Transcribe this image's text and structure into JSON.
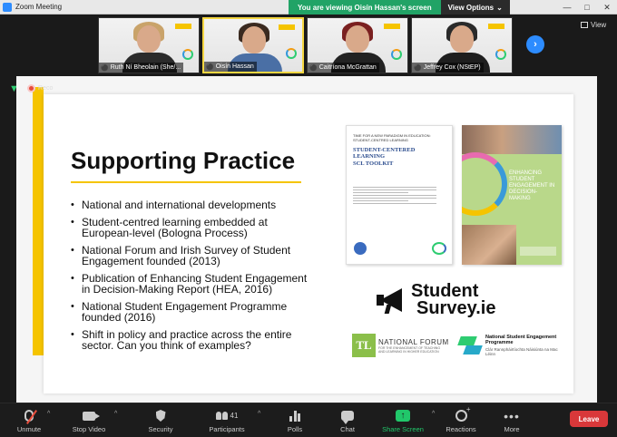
{
  "window": {
    "title": "Zoom Meeting"
  },
  "share_banner": {
    "viewing_text": "You are viewing Oisín Hassan's screen",
    "view_options_label": "View Options"
  },
  "top_right": {
    "view_label": "View"
  },
  "participants": [
    {
      "name": "Ruth Ní Bheolain (She/...",
      "hair_color": "#c9a36a",
      "body_color": "#2b2b2b",
      "muted": true
    },
    {
      "name": "Oisín Hassan",
      "hair_color": "#3a2a20",
      "body_color": "#4a6fa5",
      "muted": true,
      "active": true
    },
    {
      "name": "Caitríona McGrattan",
      "hair_color": "#7a2020",
      "body_color": "#222222",
      "muted": true
    },
    {
      "name": "Jeffrey Cox (NStEP)",
      "hair_color": "#2a2a2a",
      "body_color": "#1e1e1e",
      "muted": true
    }
  ],
  "recording_label": "Reco",
  "slide": {
    "title": "Supporting Practice",
    "bullets": [
      "National and international developments",
      "Student-centred learning embedded at European-level (Bologna Process)",
      "National Forum and Irish Survey of Student Engagement founded (2013)",
      "Publication of Enhancing Student Engagement in Decision-Making Report (HEA, 2016)",
      "National Student Engagement Programme founded (2016)",
      "Shift in policy and practice across the entire sector. Can you think of examples?"
    ],
    "book1": {
      "pretitle": "TIME FOR A NEW PARADIGM IN EDUCATION: STUDENT-CENTRED LEARNING",
      "title": "STUDENT-CENTERED LEARNING",
      "subtitle": "SCL TOOLKIT"
    },
    "book2": {
      "title": "ENHANCING STUDENT ENGAGEMENT IN DECISION-MAKING"
    },
    "student_survey": {
      "line1": "Student",
      "line2": "Survey.ie"
    },
    "national_forum": {
      "abbr": "TL",
      "name": "NATIONAL FORUM",
      "sub": "FOR THE ENHANCEMENT OF TEACHING AND LEARNING IN HIGHER EDUCATION"
    },
    "nsep": {
      "name": "National Student Engagement Programme",
      "irish": "Clár Rannpháirtíochta Náisiúnta na Mac Léinn"
    }
  },
  "toolbar": {
    "unmute": "Unmute",
    "stop_video": "Stop Video",
    "security": "Security",
    "participants": "Participants",
    "participants_count": "41",
    "polls": "Polls",
    "chat": "Chat",
    "share_screen": "Share Screen",
    "reactions": "Reactions",
    "more": "More",
    "leave": "Leave"
  },
  "colors": {
    "accent": "#2d8cff",
    "share_green": "#21a366",
    "leave_red": "#d9383a",
    "slide_yellow": "#f5c400"
  }
}
